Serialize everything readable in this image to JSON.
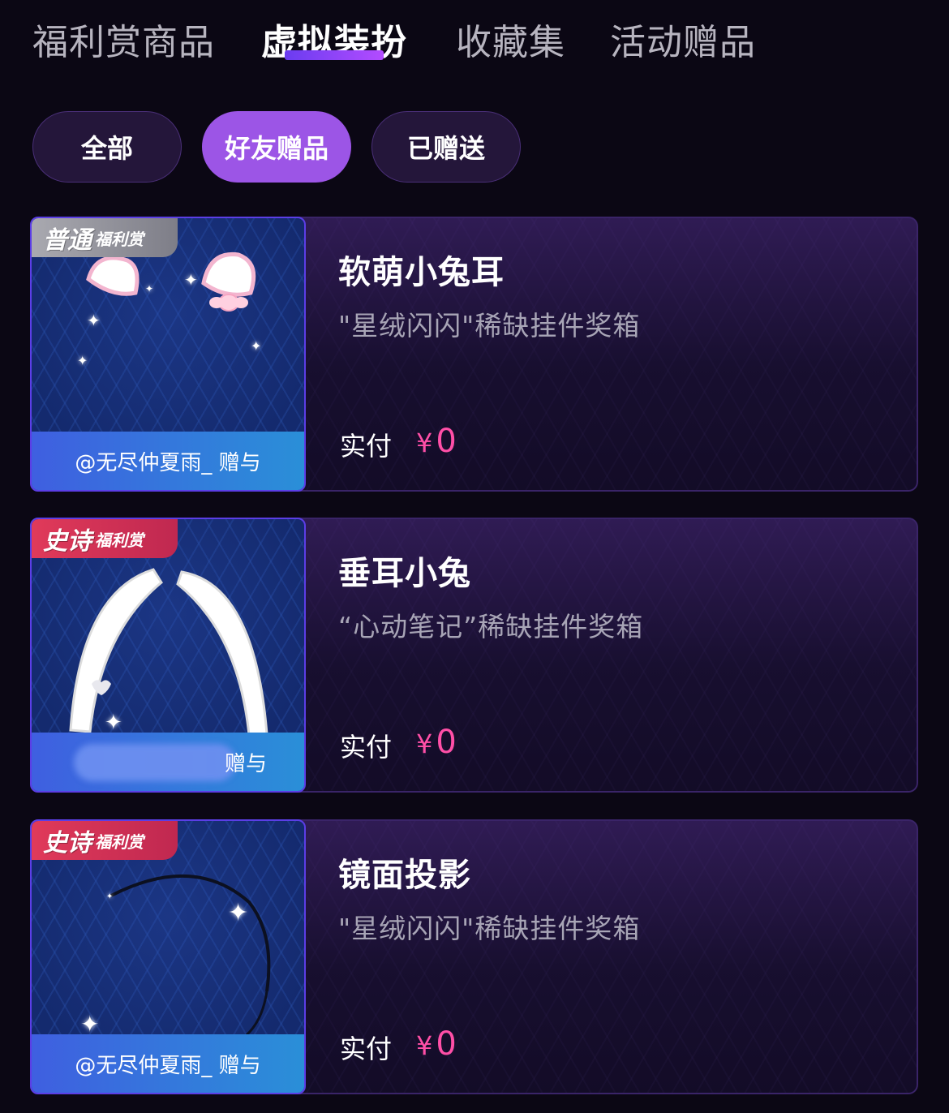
{
  "tabs": [
    {
      "label": "福利赏商品"
    },
    {
      "label": "虚拟装扮"
    },
    {
      "label": "收藏集"
    },
    {
      "label": "活动赠品"
    }
  ],
  "filters": [
    {
      "label": "全部"
    },
    {
      "label": "好友赠品"
    },
    {
      "label": "已赠送"
    }
  ],
  "items": [
    {
      "badge_big": "普通",
      "badge_small": "福利赏",
      "name": "软萌小兔耳",
      "subtitle": "\"星绒闪闪\"稀缺挂件奖箱",
      "giver": "@无尽仲夏雨_ 赠与",
      "pay_label": "实付",
      "currency": "¥",
      "price": "0"
    },
    {
      "badge_big": "史诗",
      "badge_small": "福利赏",
      "name": "垂耳小兔",
      "subtitle": "“心动笔记”稀缺挂件奖箱",
      "giver": "赠与",
      "pay_label": "实付",
      "currency": "¥",
      "price": "0"
    },
    {
      "badge_big": "史诗",
      "badge_small": "福利赏",
      "name": "镜面投影",
      "subtitle": "\"星绒闪闪\"稀缺挂件奖箱",
      "giver": "@无尽仲夏雨_ 赠与",
      "pay_label": "实付",
      "currency": "¥",
      "price": "0"
    }
  ],
  "colors": {
    "background": "#0b0714",
    "accent": "#9c55e6",
    "price": "#ff4fa7"
  }
}
